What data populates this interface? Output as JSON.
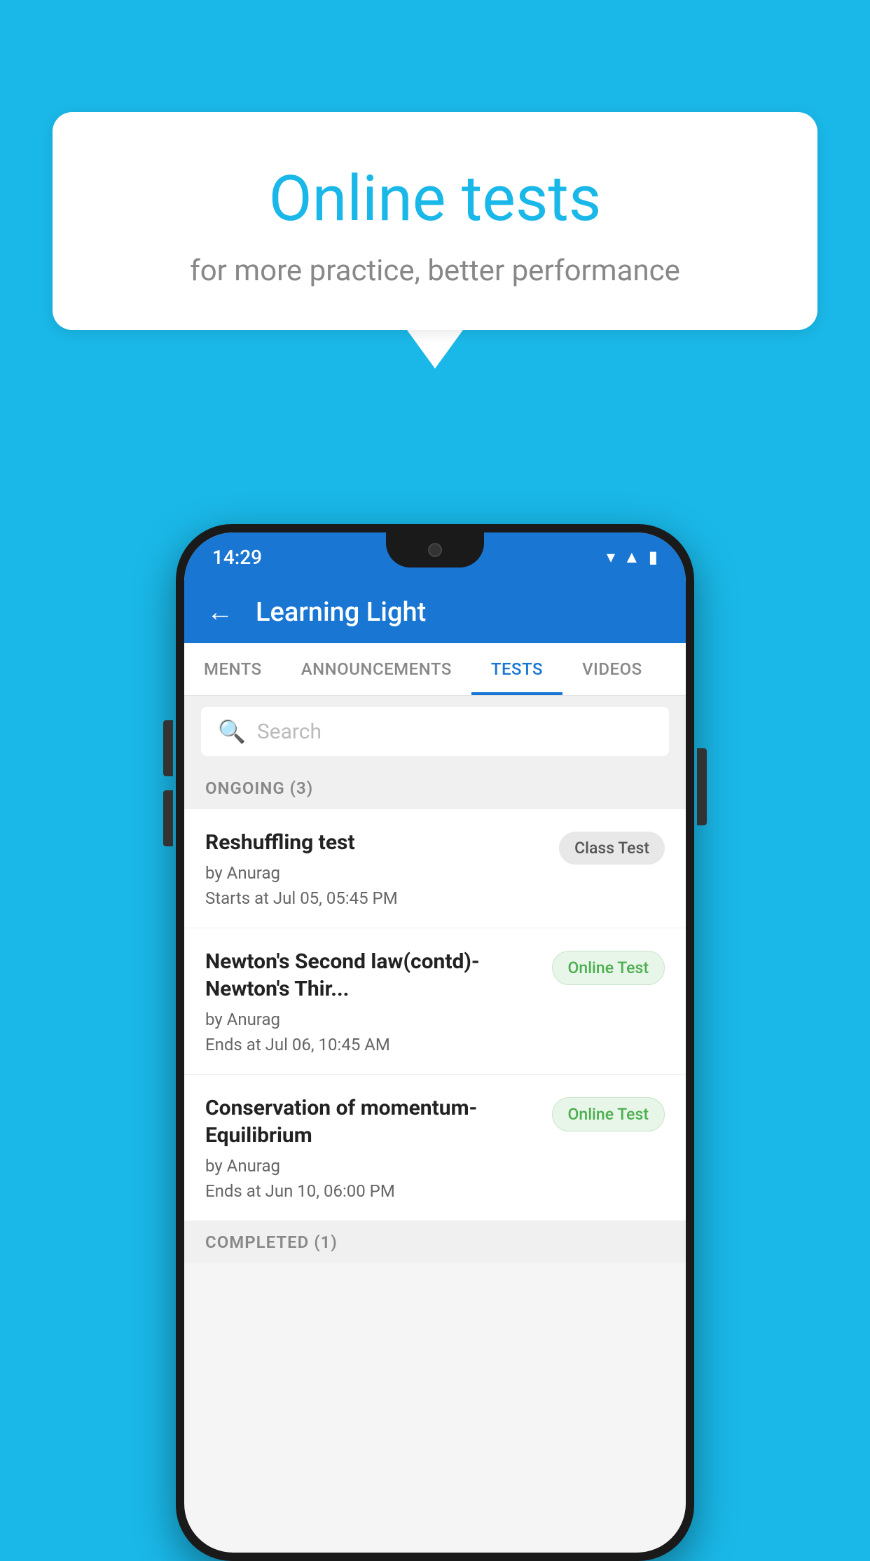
{
  "background_color": "#1ab8e8",
  "speech_bubble": {
    "title": "Online tests",
    "subtitle": "for more practice, better performance"
  },
  "phone": {
    "status_bar": {
      "time": "14:29",
      "icons": [
        "wifi",
        "signal",
        "battery"
      ]
    },
    "header": {
      "title": "Learning Light",
      "back_label": "←"
    },
    "tabs": [
      {
        "label": "MENTS",
        "active": false
      },
      {
        "label": "ANNOUNCEMENTS",
        "active": false
      },
      {
        "label": "TESTS",
        "active": true
      },
      {
        "label": "VIDEOS",
        "active": false
      }
    ],
    "search": {
      "placeholder": "Search"
    },
    "ongoing_section": {
      "label": "ONGOING (3)"
    },
    "tests": [
      {
        "name": "Reshuffling test",
        "author": "by Anurag",
        "date": "Starts at  Jul 05, 05:45 PM",
        "badge": "Class Test",
        "badge_type": "class"
      },
      {
        "name": "Newton's Second law(contd)-Newton's Thir...",
        "author": "by Anurag",
        "date": "Ends at  Jul 06, 10:45 AM",
        "badge": "Online Test",
        "badge_type": "online"
      },
      {
        "name": "Conservation of momentum-Equilibrium",
        "author": "by Anurag",
        "date": "Ends at  Jun 10, 06:00 PM",
        "badge": "Online Test",
        "badge_type": "online"
      }
    ],
    "completed_section": {
      "label": "COMPLETED (1)"
    }
  }
}
